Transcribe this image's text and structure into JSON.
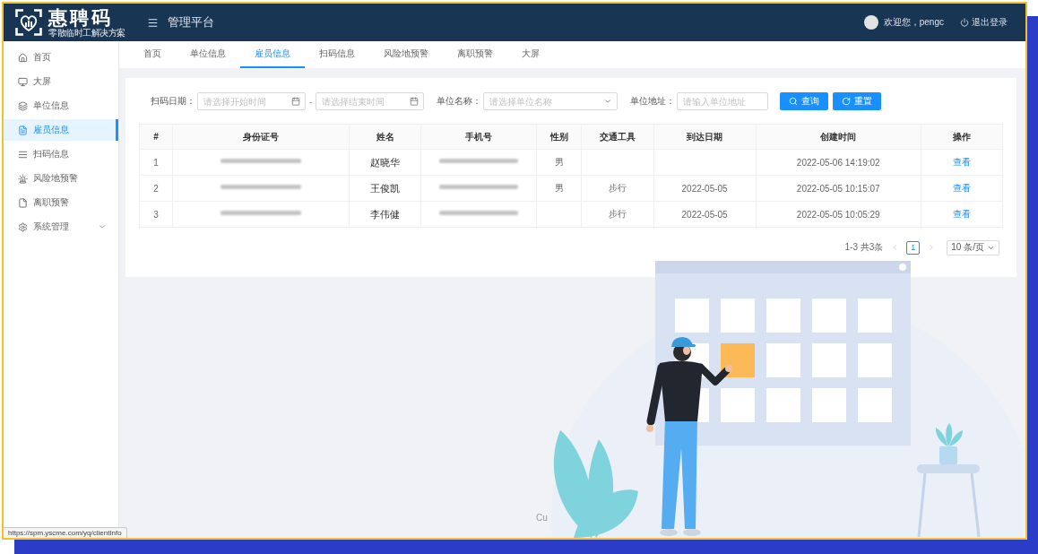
{
  "header": {
    "logo_title": "惠聘码",
    "logo_subtitle": "零散临时工解决方案",
    "app_title": "管理平台",
    "greeting": "欢迎您，pengc",
    "logout": "退出登录"
  },
  "sidebar": {
    "items": [
      {
        "label": "首页",
        "kind": "link",
        "selected": false
      },
      {
        "label": "大屏",
        "kind": "link",
        "selected": false
      },
      {
        "label": "单位信息",
        "kind": "link",
        "selected": false
      },
      {
        "label": "雇员信息",
        "kind": "link",
        "selected": true
      },
      {
        "label": "扫码信息",
        "kind": "link",
        "selected": false
      },
      {
        "label": "风险地预警",
        "kind": "link",
        "selected": false
      },
      {
        "label": "离职预警",
        "kind": "link",
        "selected": false
      },
      {
        "label": "系统管理",
        "kind": "group",
        "selected": false,
        "expanded": false
      }
    ]
  },
  "tabs": [
    {
      "label": "首页",
      "selected": false
    },
    {
      "label": "单位信息",
      "selected": false
    },
    {
      "label": "雇员信息",
      "selected": true
    },
    {
      "label": "扫码信息",
      "selected": false
    },
    {
      "label": "风险地预警",
      "selected": false
    },
    {
      "label": "离职预警",
      "selected": false
    },
    {
      "label": "大屏",
      "selected": false
    }
  ],
  "filters": {
    "date_label": "扫码日期：",
    "start_placeholder": "请选择开始时间",
    "separator": "-",
    "end_placeholder": "请选择结束时间",
    "unit_name_label": "单位名称：",
    "unit_name_placeholder": "请选择单位名称",
    "unit_address_label": "单位地址：",
    "unit_address_placeholder": "请输入单位地址",
    "buttons": [
      {
        "label": "查询"
      },
      {
        "label": "重置"
      }
    ]
  },
  "table": {
    "columns": [
      "#",
      "身份证号",
      "姓名",
      "手机号",
      "性别",
      "交通工具",
      "到达日期",
      "创建时间",
      "操作"
    ],
    "rows": [
      {
        "index": "1",
        "id_redacted": true,
        "name": "赵晓华",
        "phone_redacted": true,
        "gender": "男",
        "created_at": "2022-05-06 14:19:02",
        "action": "查看"
      },
      {
        "index": "2",
        "id_redacted": true,
        "name": "王俊凯",
        "phone_redacted": true,
        "gender": "男",
        "transport": "步行",
        "arrival_date": "2022-05-05",
        "created_at": "2022-05-05 10:15:07",
        "action": "查看"
      },
      {
        "index": "3",
        "id_redacted": true,
        "name": "李伟健",
        "phone_redacted": true,
        "transport": "步行",
        "arrival_date": "2022-05-05",
        "created_at": "2022-05-05 10:05:29",
        "action": "查看"
      }
    ]
  },
  "pagination": {
    "summary": "1-3 共3条",
    "prev_disabled": true,
    "pages": [
      {
        "label": "1",
        "selected": true
      }
    ],
    "next_disabled": true,
    "page_size": "10 条/页"
  },
  "footer": {
    "text": "Cu"
  },
  "status_bar": {
    "url": "https://spm.yscme.com/yq/clientInfo"
  }
}
